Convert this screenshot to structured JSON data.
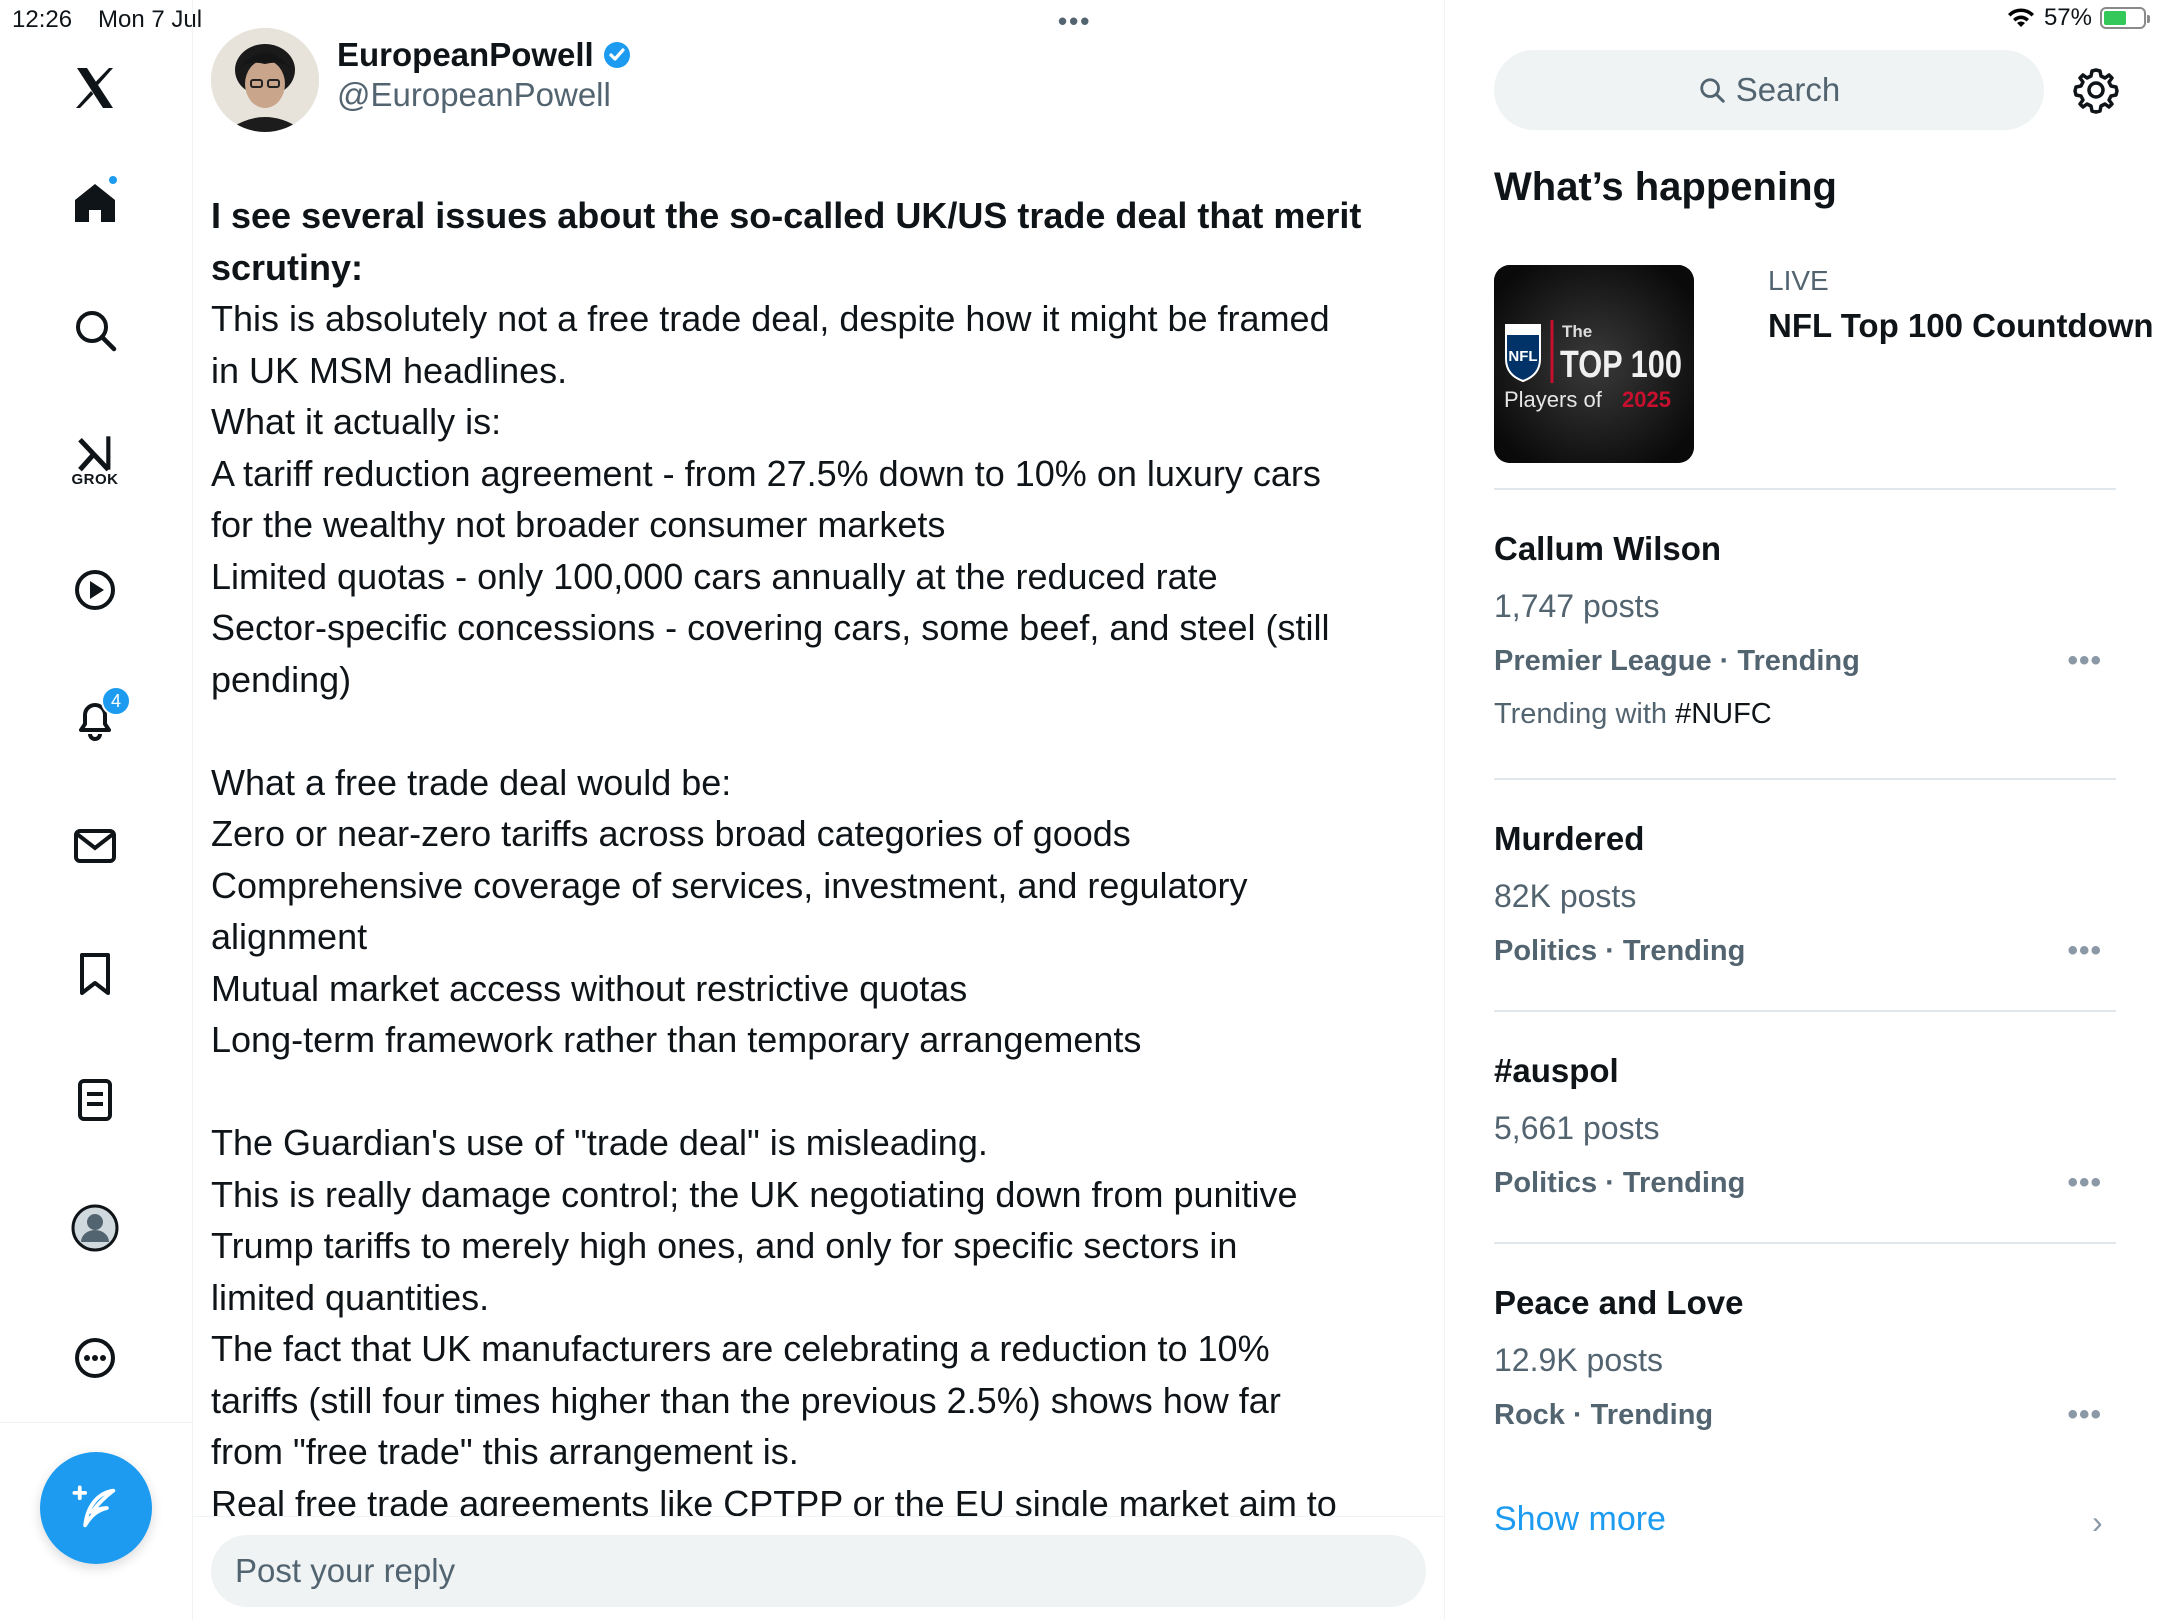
{
  "status_bar": {
    "time": "12:26",
    "date": "Mon 7 Jul",
    "battery": "57%",
    "battery_level": 0.57
  },
  "nav": {
    "grok_label": "GROK",
    "notifications_badge": "4",
    "icons": [
      "x-logo-icon",
      "home-icon",
      "search-icon",
      "grok-icon",
      "video-icon",
      "bell-icon",
      "mail-icon",
      "bookmark-icon",
      "lists-icon",
      "profile-icon",
      "more-icon",
      "compose-icon"
    ]
  },
  "post": {
    "author_name": "EuropeanPowell",
    "author_handle": "@EuropeanPowell",
    "verified": true,
    "lines": [
      {
        "text": "I see several issues about the so-called UK/US trade deal that merit",
        "bold": true
      },
      {
        "text": "scrutiny:",
        "bold": true
      },
      {
        "text": "This is absolutely not a free trade deal, despite how it might be framed"
      },
      {
        "text": "in UK MSM headlines."
      },
      {
        "text": "What it actually is:"
      },
      {
        "text": "A tariff reduction agreement - from 27.5% down to 10% on luxury cars"
      },
      {
        "text": "for the wealthy not broader consumer markets"
      },
      {
        "text": "Limited quotas - only 100,000 cars annually at the reduced rate"
      },
      {
        "text": "Sector-specific concessions - covering cars, some beef, and steel (still"
      },
      {
        "text": "pending)"
      },
      {
        "text": ""
      },
      {
        "text": "What a free trade deal would be:"
      },
      {
        "text": "Zero or near-zero tariffs across broad categories of goods"
      },
      {
        "text": "Comprehensive coverage of services, investment, and regulatory"
      },
      {
        "text": "alignment"
      },
      {
        "text": "Mutual market access without restrictive quotas"
      },
      {
        "text": "Long-term framework rather than temporary arrangements"
      },
      {
        "text": ""
      },
      {
        "text": "The Guardian's use of \"trade deal\" is misleading."
      },
      {
        "text": "This is really damage control; the UK negotiating down from punitive"
      },
      {
        "text": "Trump tariffs to merely high ones, and only for specific sectors in"
      },
      {
        "text": "limited quantities."
      },
      {
        "text": "The fact that UK manufacturers are celebrating a reduction to 10%"
      },
      {
        "text": "tariffs (still four times higher than the previous 2.5%) shows how far"
      },
      {
        "text": "from \"free trade\" this arrangement is."
      },
      {
        "text": "Real free trade agreements like CPTPP or the EU single market aim to"
      }
    ]
  },
  "reply": {
    "placeholder": "Post your reply"
  },
  "sidebar": {
    "search_placeholder": "Search",
    "section_title": "What’s happening",
    "live": {
      "tag": "LIVE",
      "title": "NFL Top 100 Countdown",
      "thumb_the": "The",
      "thumb_top": "TOP 100",
      "thumb_players": "Players of",
      "thumb_year": "2025",
      "thumb_nfl": "NFL"
    },
    "trends": [
      {
        "title": "Callum Wilson",
        "count": "1,747 posts",
        "category": "Premier League · Trending",
        "with_prefix": "Trending with ",
        "with_tag": "#NUFC"
      },
      {
        "title": "Murdered",
        "count": "82K posts",
        "category": "Politics · Trending"
      },
      {
        "title": "#auspol",
        "count": "5,661 posts",
        "category": "Politics · Trending"
      },
      {
        "title": "Peace and Love",
        "count": "12.9K posts",
        "category": "Rock · Trending"
      }
    ],
    "show_more": "Show more",
    "more_dots": "•••"
  },
  "colors": {
    "accent": "#1d9bf0",
    "text": "#0f1419",
    "muted": "#536471",
    "divider": "#e1e8ed",
    "search_bg": "#eff3f4"
  }
}
